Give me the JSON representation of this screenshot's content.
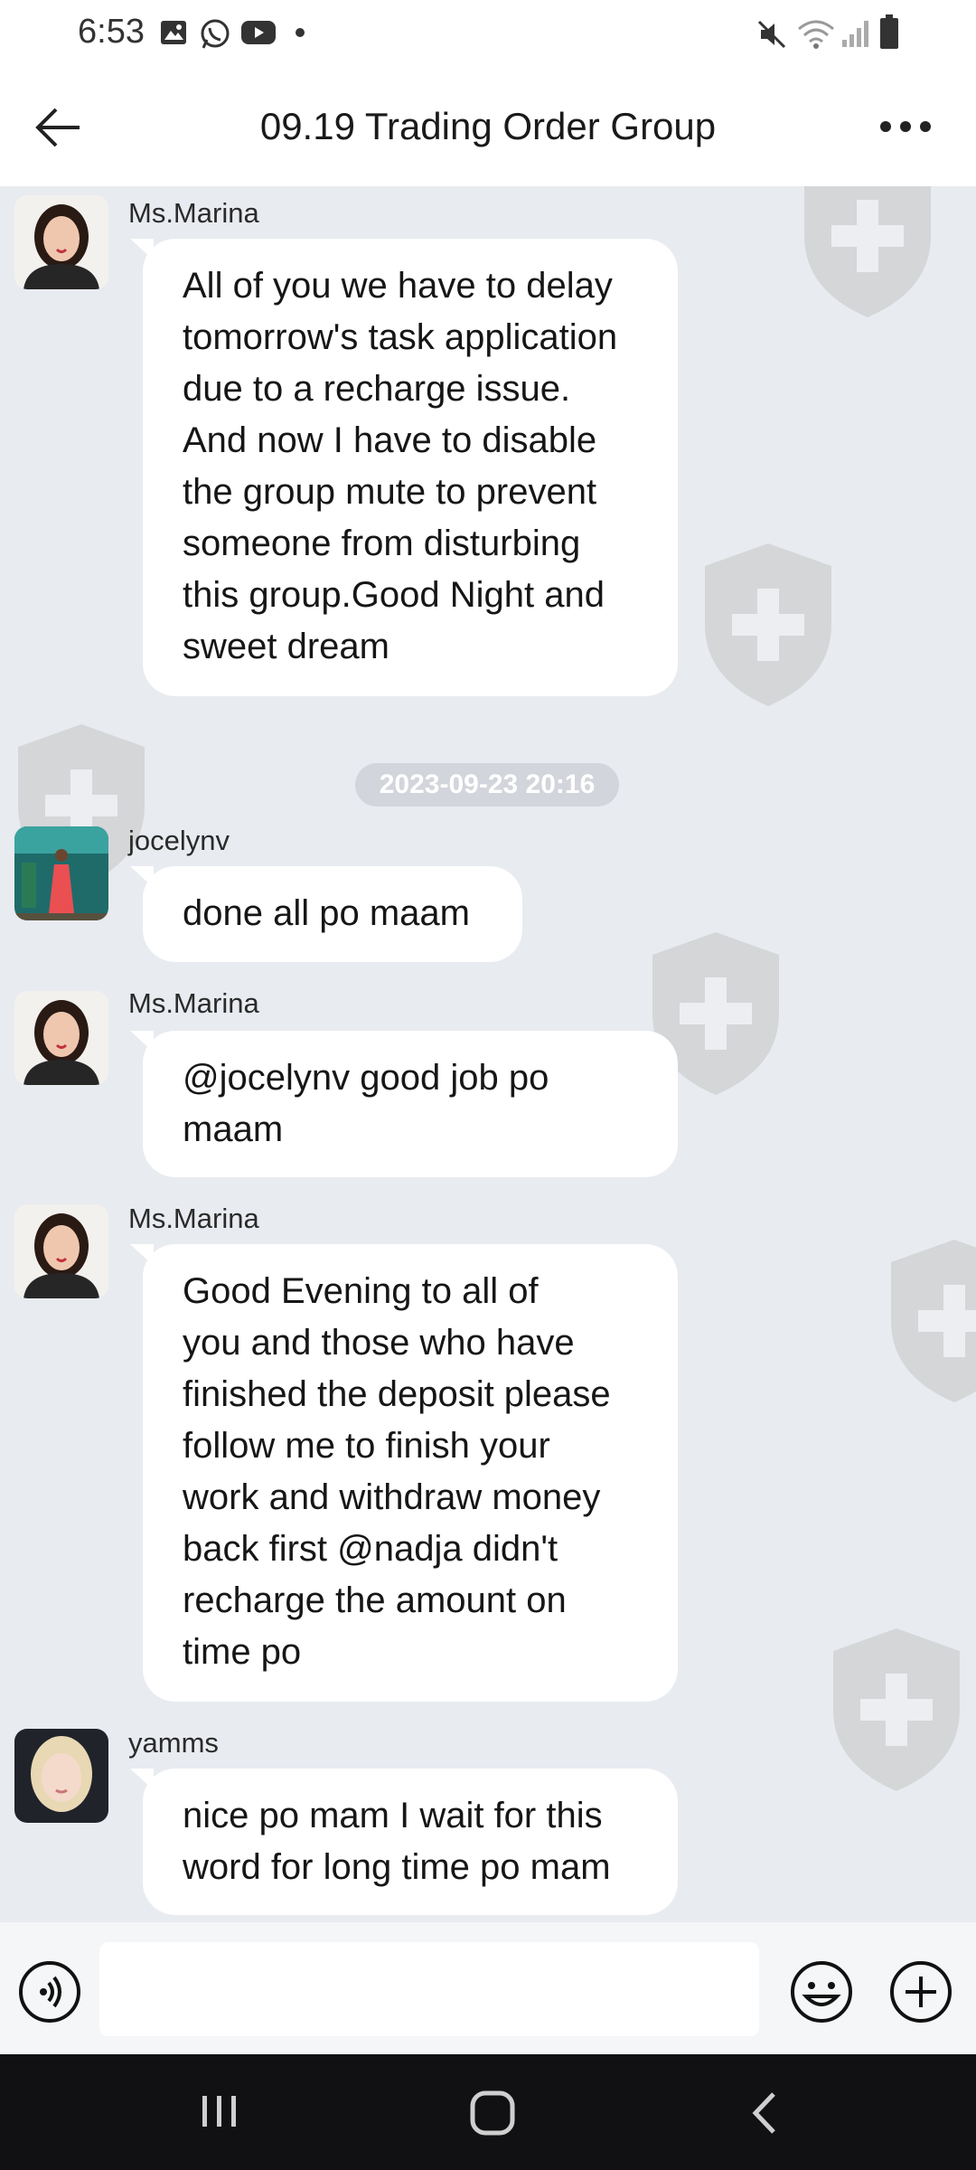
{
  "status": {
    "time": "6:53"
  },
  "header": {
    "title": "09.19  Trading Order Group"
  },
  "chat": {
    "timestamp": "2023-09-23 20:16",
    "messages": [
      {
        "sender": "Ms.Marina",
        "lines": [
          "All of you we have to delay",
          "tomorrow's task application",
          "due to a recharge issue.",
          "And now I have to disable",
          "the group mute to prevent",
          "someone from disturbing",
          "this group.Good Night and",
          "sweet dream"
        ]
      },
      {
        "sender": "jocelynv",
        "lines": [
          "done all po maam"
        ]
      },
      {
        "sender": "Ms.Marina",
        "lines": [
          "@jocelynv good job po",
          "maam"
        ]
      },
      {
        "sender": "Ms.Marina",
        "lines": [
          "Good Evening to all of",
          "you and those who have",
          "finished the deposit please",
          "follow me to finish your",
          "work and withdraw money",
          "back first @nadja  didn't",
          "recharge the amount on",
          "time po"
        ]
      },
      {
        "sender": "yamms",
        "lines": [
          "nice po mam I wait for this",
          "word for long time po mam"
        ]
      }
    ]
  },
  "input": {
    "placeholder": ""
  },
  "colors": {
    "chat_background": "#e8ebf0",
    "bubble": "#ffffff",
    "timestamp_pill": "#d2d5db",
    "navbar": "#111114"
  }
}
